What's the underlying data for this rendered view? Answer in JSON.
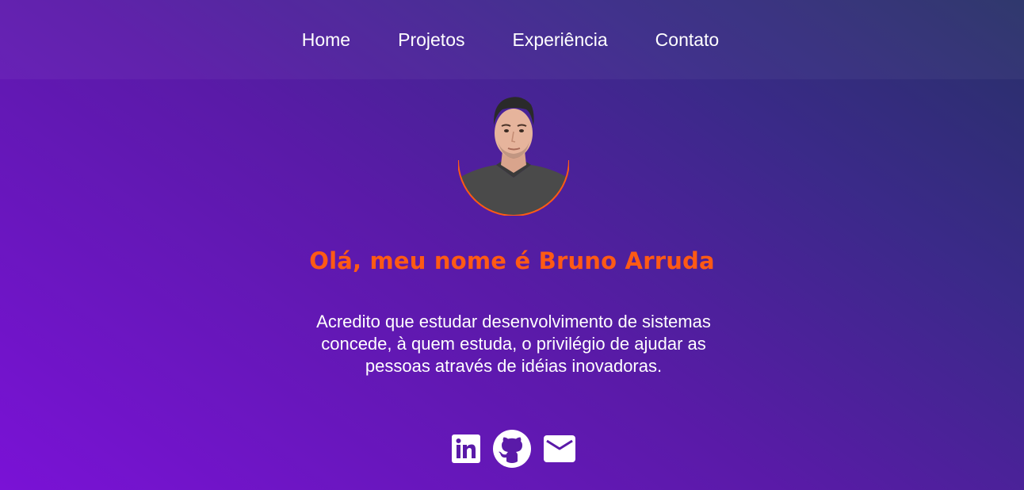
{
  "nav": {
    "items": [
      {
        "label": "Home"
      },
      {
        "label": "Projetos"
      },
      {
        "label": "Experiência"
      },
      {
        "label": "Contato"
      }
    ]
  },
  "hero": {
    "title": "Olá, meu nome é Bruno Arruda",
    "bio": "Acredito que estudar desenvolvimento de sistemas concede, à quem estuda, o privilégio de ajudar as pessoas através de idéias inovadoras."
  },
  "socials": [
    {
      "icon": "linkedin-icon"
    },
    {
      "icon": "github-icon"
    },
    {
      "icon": "mail-icon"
    }
  ],
  "colors": {
    "accent": "#ff5a14",
    "gradient_start": "#7a12d6",
    "gradient_end": "#283068"
  }
}
